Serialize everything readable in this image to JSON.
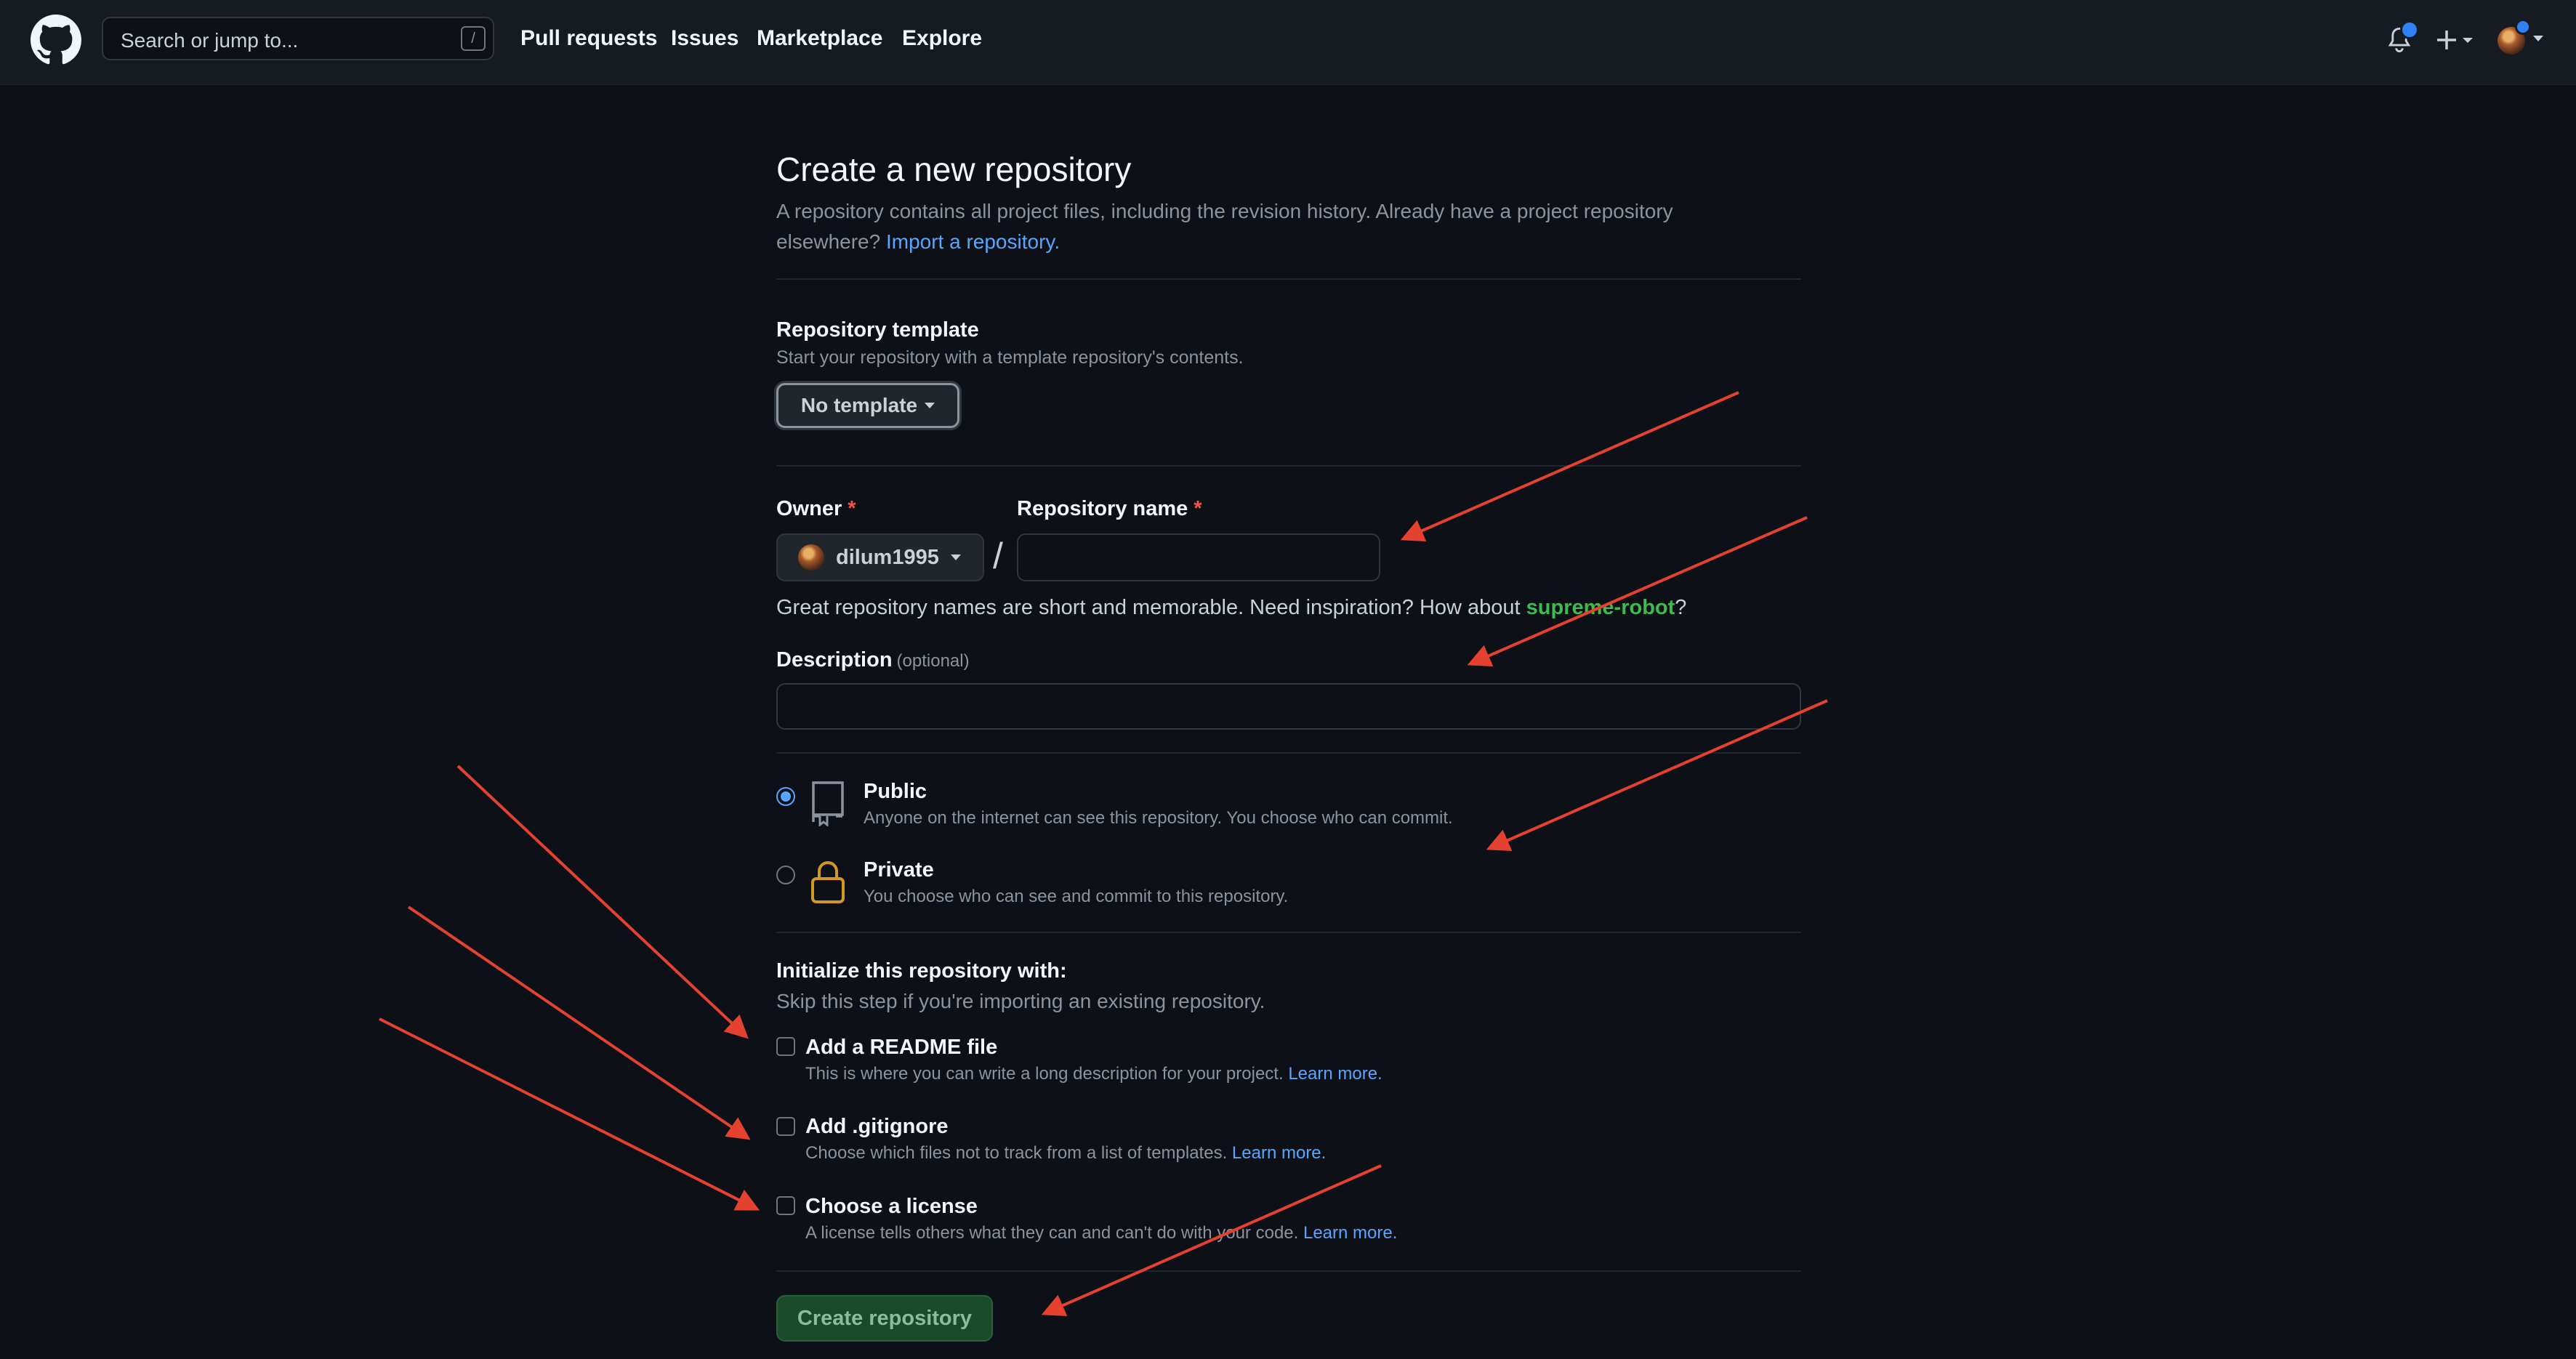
{
  "header": {
    "search_placeholder": "Search or jump to...",
    "search_shortcut": "/",
    "nav": [
      "Pull requests",
      "Issues",
      "Marketplace",
      "Explore"
    ],
    "notification_dot_color": "#2f81f7"
  },
  "page": {
    "title": "Create a new repository",
    "intro_line1": "A repository contains all project files, including the revision history. Already have a project repository",
    "intro_line2": "elsewhere?",
    "import_link": "Import a repository."
  },
  "template": {
    "label": "Repository template",
    "help": "Start your repository with a template repository's contents.",
    "button": "No template"
  },
  "owner": {
    "label": "Owner",
    "required_mark": "*",
    "value": "dilum1995"
  },
  "repo_name": {
    "label": "Repository name",
    "required_mark": "*",
    "separator": "/",
    "value": "",
    "hint_prefix": "Great repository names are short and memorable. Need inspiration? How about",
    "suggestion": "supreme-robot",
    "hint_suffix": "?"
  },
  "description": {
    "label": "Description",
    "optional": "(optional)",
    "value": ""
  },
  "visibility": {
    "options": [
      {
        "title": "Public",
        "desc": "Anyone on the internet can see this repository. You choose who can commit.",
        "checked": true
      },
      {
        "title": "Private",
        "desc": "You choose who can see and commit to this repository.",
        "checked": false
      }
    ]
  },
  "initialize": {
    "heading": "Initialize this repository with:",
    "sub": "Skip this step if you're importing an existing repository.",
    "items": [
      {
        "title": "Add a README file",
        "desc": "This is where you can write a long description for your project.",
        "link": "Learn more."
      },
      {
        "title": "Add .gitignore",
        "desc": "Choose which files not to track from a list of templates.",
        "link": "Learn more."
      },
      {
        "title": "Choose a license",
        "desc": "A license tells others what they can and can't do with your code.",
        "link": "Learn more."
      }
    ]
  },
  "submit": {
    "label": "Create repository"
  },
  "colors": {
    "link": "#58a6ff",
    "suggestion": "#3fb950",
    "annotation_arrow": "#e5412f",
    "lock": "#d29922"
  }
}
